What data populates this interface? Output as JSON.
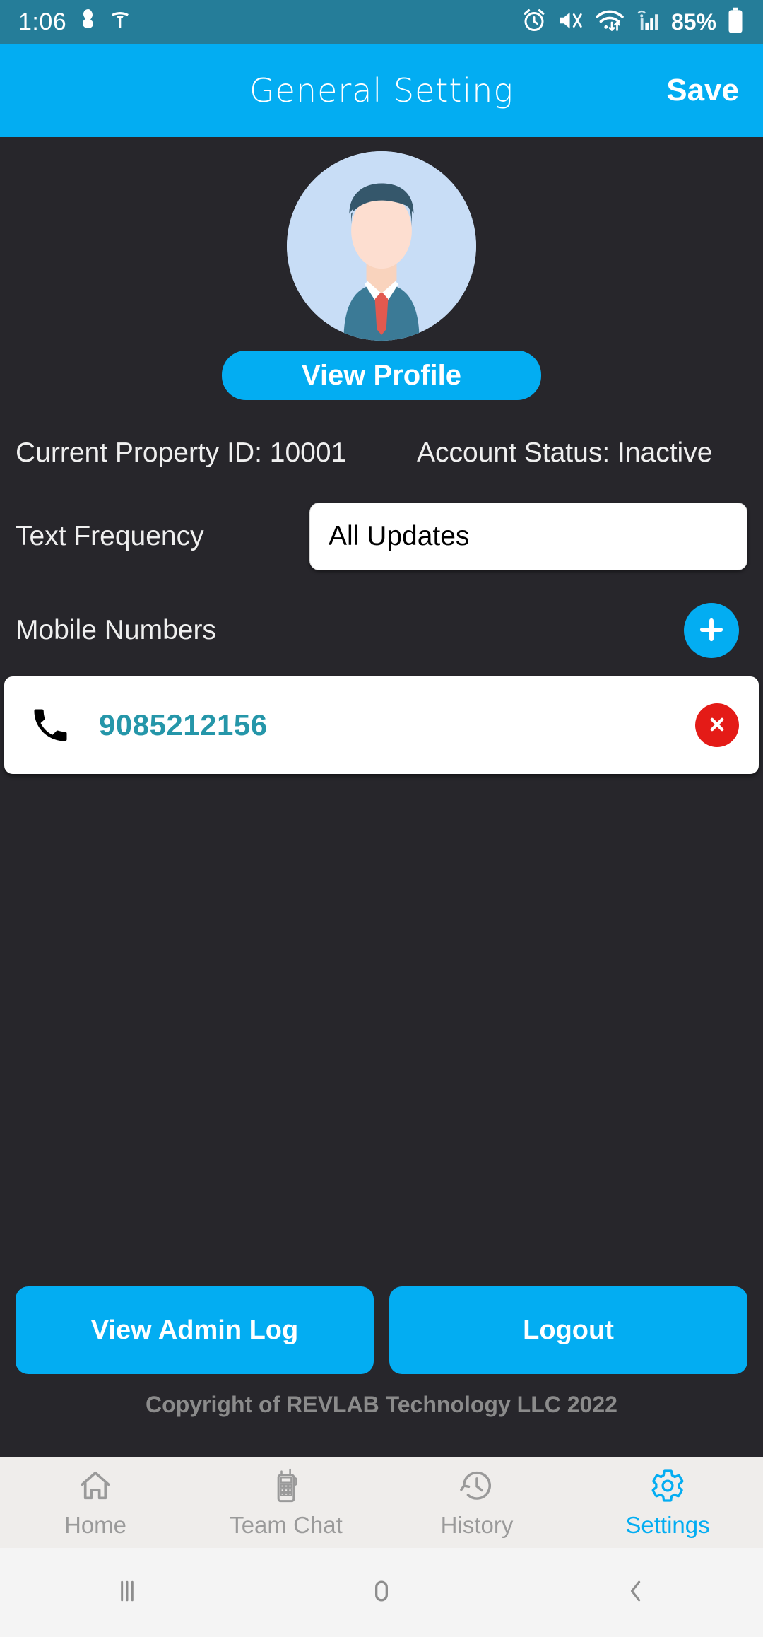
{
  "status_bar": {
    "time": "1:06",
    "battery_percent": "85%",
    "left_icons": [
      "location-pin-icon",
      "tesla-icon"
    ],
    "right_icons": [
      "alarm-icon",
      "mute-vibrate-icon",
      "wifi-icon",
      "signal-bars-icon",
      "battery-icon"
    ],
    "background_color": "#257d99"
  },
  "app_bar": {
    "title": "General Setting",
    "save_label": "Save",
    "background_color": "#03ADF2"
  },
  "profile": {
    "avatar_name": "user-avatar",
    "view_profile_label": "View Profile"
  },
  "info": {
    "property_label": "Current Property ID: 10001",
    "account_status": "Account Status: Inactive"
  },
  "text_frequency": {
    "label": "Text Frequency",
    "selected": "All Updates",
    "options": [
      "All Updates"
    ]
  },
  "mobile_numbers": {
    "label": "Mobile Numbers",
    "add_icon": "plus-icon",
    "items": [
      {
        "number": "9085212156",
        "phone_icon": "phone-icon",
        "delete_icon": "close-circle-icon"
      }
    ]
  },
  "actions": {
    "view_admin_log_label": "View Admin Log",
    "logout_label": "Logout"
  },
  "footer": {
    "copyright": "Copyright of REVLAB Technology LLC 2022"
  },
  "tab_bar": {
    "items": [
      {
        "label": "Home",
        "icon": "home-icon",
        "active": false
      },
      {
        "label": "Team Chat",
        "icon": "walkie-talkie-icon",
        "active": false
      },
      {
        "label": "History",
        "icon": "history-clock-icon",
        "active": false
      },
      {
        "label": "Settings",
        "icon": "gear-icon",
        "active": true
      }
    ],
    "active_color": "#03ADF2",
    "inactive_color": "#9a9a9a"
  },
  "android_nav": {
    "recents_label": "recents-icon",
    "home_label": "home-pill-icon",
    "back_label": "back-chevron-icon"
  }
}
